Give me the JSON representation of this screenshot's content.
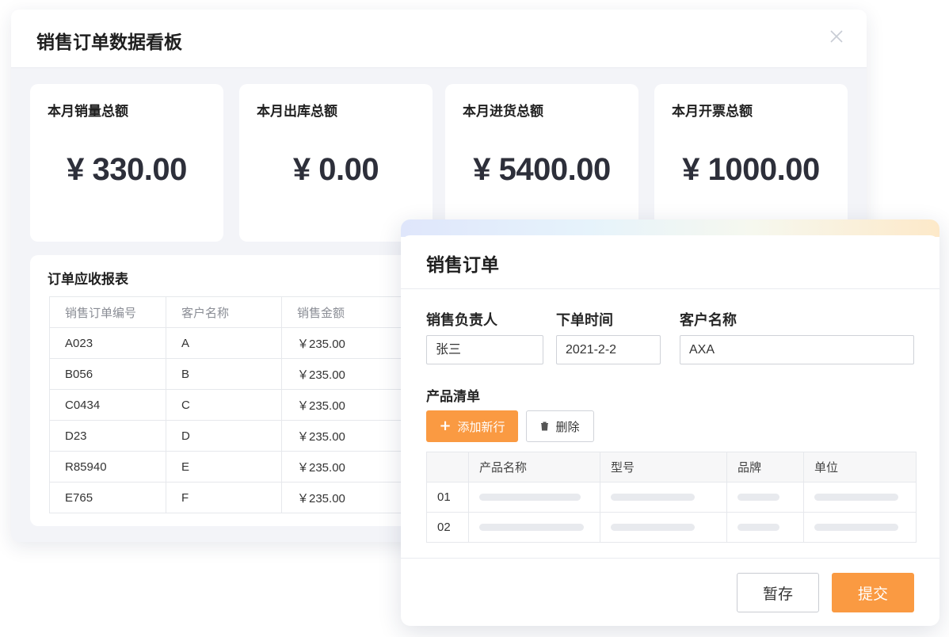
{
  "dashboard": {
    "title": "销售订单数据看板",
    "kpis": [
      {
        "label": "本月销量总额",
        "value": "¥ 330.00"
      },
      {
        "label": "本月出库总额",
        "value": "¥ 0.00"
      },
      {
        "label": "本月进货总额",
        "value": "¥ 5400.00"
      },
      {
        "label": "本月开票总额",
        "value": "¥ 1000.00"
      }
    ],
    "report": {
      "title": "订单应收报表",
      "headers": [
        "销售订单编号",
        "客户名称",
        "销售金额"
      ],
      "rows": [
        [
          "A023",
          "A",
          "￥235.00"
        ],
        [
          "B056",
          "B",
          "￥235.00"
        ],
        [
          "C0434",
          "C",
          "￥235.00"
        ],
        [
          "D23",
          "D",
          "￥235.00"
        ],
        [
          "R85940",
          "E",
          "￥235.00"
        ],
        [
          "E765",
          "F",
          "￥235.00"
        ]
      ]
    }
  },
  "order_form": {
    "title": "销售订单",
    "fields": {
      "salesperson": {
        "label": "销售负责人",
        "value": "张三"
      },
      "order_date": {
        "label": "下单时间",
        "value": "2021-2-2"
      },
      "customer": {
        "label": "客户名称",
        "value": "AXA"
      }
    },
    "product_section": {
      "label": "产品清单",
      "add_label": "添加新行",
      "delete_label": "删除",
      "headers": [
        "",
        "产品名称",
        "型号",
        "品牌",
        "单位"
      ],
      "rows": [
        "01",
        "02"
      ]
    },
    "save_label": "暂存",
    "submit_label": "提交"
  },
  "colors": {
    "accent": "#fa9a42",
    "background": "#f3f4f8"
  }
}
